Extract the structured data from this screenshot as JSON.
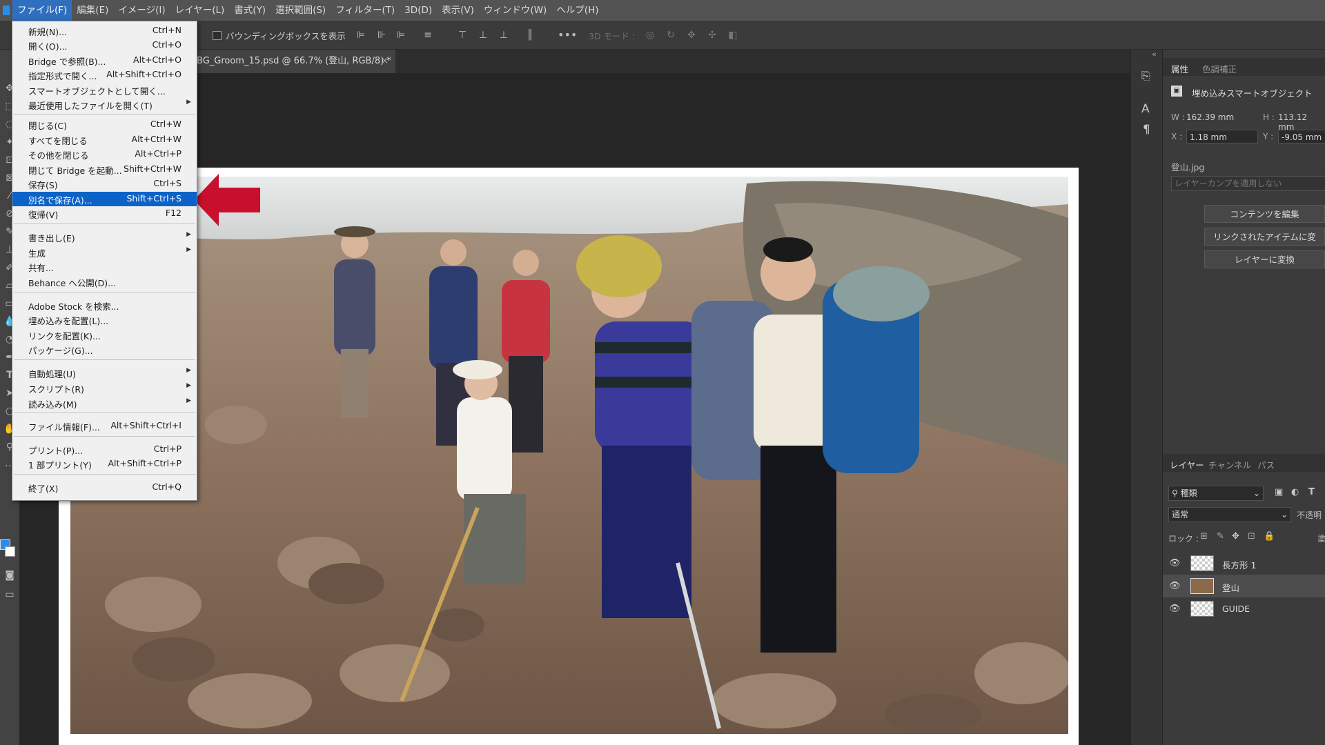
{
  "menubar": {
    "items": [
      "ファイル(F)",
      "編集(E)",
      "イメージ(I)",
      "レイヤー(L)",
      "書式(Y)",
      "選択範囲(S)",
      "フィルター(T)",
      "3D(D)",
      "表示(V)",
      "ウィンドウ(W)",
      "ヘルプ(H)"
    ]
  },
  "options": {
    "bbox_label": "バウンディングボックスを表示",
    "mode3d_label": "3D モード :"
  },
  "document": {
    "tab_title": "BG_Groom_15.psd @ 66.7% (登山, RGB/8) *",
    "close_glyph": "×"
  },
  "file_menu": {
    "items": [
      {
        "label": "新規(N)...",
        "shortcut": "Ctrl+N"
      },
      {
        "label": "開く(O)...",
        "shortcut": "Ctrl+O"
      },
      {
        "label": "Bridge で参照(B)...",
        "shortcut": "Alt+Ctrl+O"
      },
      {
        "label": "指定形式で開く...",
        "shortcut": "Alt+Shift+Ctrl+O"
      },
      {
        "label": "スマートオブジェクトとして開く...",
        "shortcut": ""
      },
      {
        "label": "最近使用したファイルを開く(T)",
        "shortcut": ""
      },
      {
        "label": "閉じる(C)",
        "shortcut": "Ctrl+W"
      },
      {
        "label": "すべてを閉じる",
        "shortcut": "Alt+Ctrl+W"
      },
      {
        "label": "その他を閉じる",
        "shortcut": "Alt+Ctrl+P"
      },
      {
        "label": "閉じて Bridge を起動...",
        "shortcut": "Shift+Ctrl+W"
      },
      {
        "label": "保存(S)",
        "shortcut": "Ctrl+S"
      },
      {
        "label": "別名で保存(A)...",
        "shortcut": "Shift+Ctrl+S"
      },
      {
        "label": "復帰(V)",
        "shortcut": "F12"
      },
      {
        "label": "書き出し(E)",
        "shortcut": ""
      },
      {
        "label": "生成",
        "shortcut": ""
      },
      {
        "label": "共有...",
        "shortcut": ""
      },
      {
        "label": "Behance へ公開(D)...",
        "shortcut": ""
      },
      {
        "label": "Adobe Stock を検索...",
        "shortcut": ""
      },
      {
        "label": "埋め込みを配置(L)...",
        "shortcut": ""
      },
      {
        "label": "リンクを配置(K)...",
        "shortcut": ""
      },
      {
        "label": "パッケージ(G)...",
        "shortcut": ""
      },
      {
        "label": "自動処理(U)",
        "shortcut": ""
      },
      {
        "label": "スクリプト(R)",
        "shortcut": ""
      },
      {
        "label": "読み込み(M)",
        "shortcut": ""
      },
      {
        "label": "ファイル情報(F)...",
        "shortcut": "Alt+Shift+Ctrl+I"
      },
      {
        "label": "プリント(P)...",
        "shortcut": "Ctrl+P"
      },
      {
        "label": "1 部プリント(Y)",
        "shortcut": "Alt+Shift+Ctrl+P"
      },
      {
        "label": "終了(X)",
        "shortcut": "Ctrl+Q"
      }
    ]
  },
  "properties": {
    "tab_active": "属性",
    "tab_other": "色調補正",
    "object_type": "埋め込みスマートオブジェクト",
    "w_label": "W :",
    "w_value": "162.39 mm",
    "h_label": "H :",
    "h_value": "113.12 mm",
    "x_label": "X :",
    "x_value": "1.18 mm",
    "y_label": "Y :",
    "y_value": "-9.05 mm",
    "filename": "登山.jpg",
    "comp_placeholder": "レイヤーカンプを適用しない",
    "btn_edit": "コンテンツを編集",
    "btn_convert_linked": "リンクされたアイテムに変換...",
    "btn_to_layers": "レイヤーに変換"
  },
  "layers_panel": {
    "tabs": [
      "レイヤー",
      "チャンネル",
      "パス"
    ],
    "filter_label": "種類",
    "blend_mode": "通常",
    "opacity_label": "不透明",
    "lock_label": "ロック :",
    "fill_label": "塗",
    "layers": [
      {
        "name": "長方形 1"
      },
      {
        "name": "登山"
      },
      {
        "name": "GUIDE"
      }
    ]
  },
  "colors": {
    "arrow": "#c8102e",
    "highlight": "#0c63c7"
  }
}
